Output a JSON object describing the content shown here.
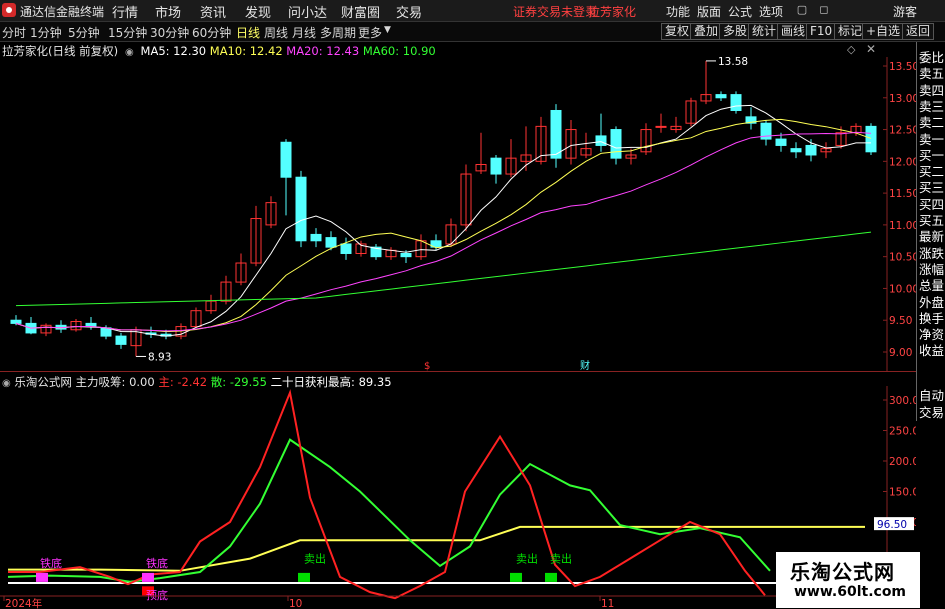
{
  "menu": {
    "app_title": "通达信金融终端",
    "items": [
      "行情",
      "市场",
      "资讯",
      "发现",
      "问小达",
      "财富圈",
      "交易"
    ],
    "status": "证券交易未登录",
    "stock_name": "拉芳家化",
    "right_items": [
      "功能",
      "版面",
      "公式",
      "选项"
    ],
    "user": "游客"
  },
  "toolbar": {
    "periods": [
      "分时",
      "1分钟",
      "5分钟",
      "15分钟",
      "30分钟",
      "60分钟",
      "日线",
      "周线",
      "月线",
      "多周期",
      "更多"
    ],
    "active_period": "日线",
    "right_buttons": [
      "复权",
      "叠加",
      "多股",
      "统计",
      "画线",
      "F10",
      "标记",
      "+自选",
      "返回"
    ]
  },
  "kline": {
    "title": "拉芳家化(日线 前复权)",
    "ma": [
      {
        "label": "MA5: 12.30",
        "color": "#ffffff"
      },
      {
        "label": "MA10: 12.42",
        "color": "#ffff55"
      },
      {
        "label": "MA20: 12.43",
        "color": "#ff44ff"
      },
      {
        "label": "MA60: 10.90",
        "color": "#33ff33"
      }
    ],
    "y_ticks": [
      "13.50",
      "13.00",
      "12.50",
      "12.00",
      "11.50",
      "11.00",
      "10.50",
      "10.00",
      "9.50",
      "9.00"
    ],
    "high_label": "13.58",
    "low_label": "8.93",
    "event_markers": [
      "$",
      "财"
    ],
    "up_color": "#ff3333",
    "down_color": "#54ffff"
  },
  "side_panel": {
    "items": [
      "委比",
      "卖五",
      "卖四",
      "卖三",
      "卖二",
      "卖一",
      "买一",
      "买二",
      "买三",
      "买四",
      "买五",
      "最新",
      "涨跌",
      "涨幅",
      "总量",
      "外盘",
      "换手",
      "净资",
      "收益"
    ],
    "bottom_items": [
      "自动",
      "交易"
    ]
  },
  "indicator": {
    "source": "乐淘公式网",
    "series_labels": [
      {
        "label": "主力吸筹: 0.00",
        "color": "#e6e6e6"
      },
      {
        "label": "主: -2.42",
        "color": "#ff3333"
      },
      {
        "label": "散: -29.55",
        "color": "#33ff33"
      },
      {
        "label": "二十日获利最高: 89.35",
        "color": "#ffffff"
      }
    ],
    "y_ticks": [
      "300.0",
      "250.0",
      "200.0",
      "150.0",
      "100.0"
    ],
    "current_value": "96.50",
    "annotations": [
      "铁底",
      "铁底",
      "卖出",
      "卖出",
      "卖出",
      "预底"
    ],
    "x_labels": [
      "2024年",
      "10",
      "11"
    ]
  },
  "watermark": {
    "title": "乐淘公式网",
    "url": "www.60lt.com"
  }
}
